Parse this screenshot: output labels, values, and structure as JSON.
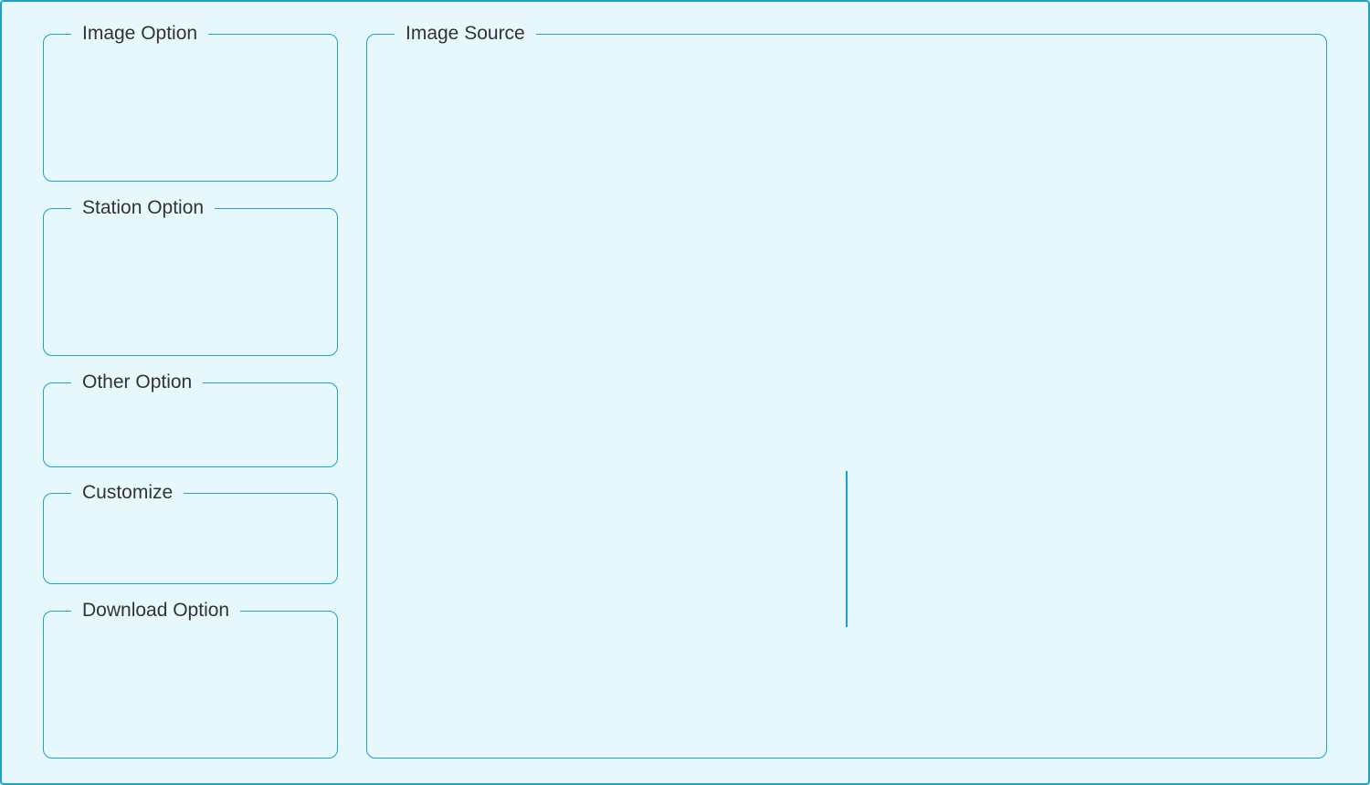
{
  "colors": {
    "background": "#e6f8fc",
    "border": "#1fa0c4",
    "text": "#333333"
  },
  "groups": {
    "image_option": {
      "title": "Image Option"
    },
    "station_option": {
      "title": "Station Option"
    },
    "other_option": {
      "title": "Other Option"
    },
    "customize": {
      "title": "Customize"
    },
    "download_option": {
      "title": "Download Option"
    },
    "image_source": {
      "title": "Image Source"
    }
  }
}
